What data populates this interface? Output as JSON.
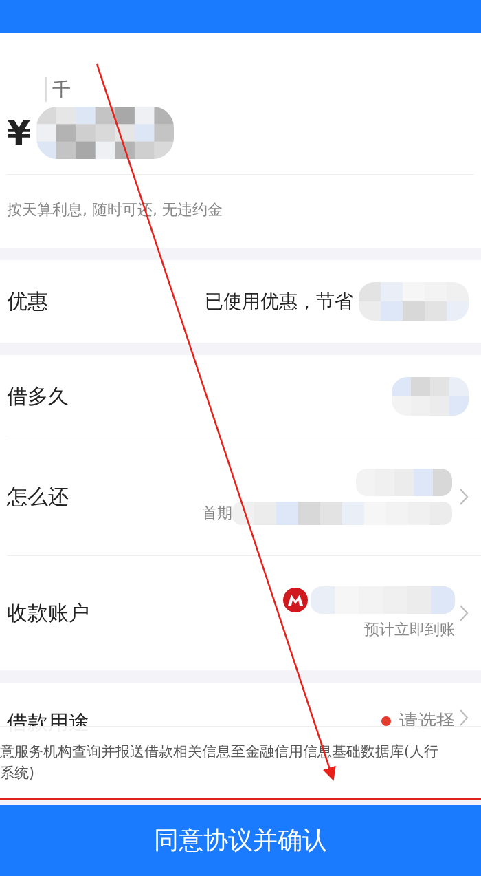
{
  "amount": {
    "unit": "千",
    "currency": "¥"
  },
  "note": "按天算利息, 随时可还, 无违约金",
  "sections": [
    {
      "rows": [
        {
          "kind": "value",
          "label": "优惠",
          "value": "已使用优惠，节省",
          "chevron": false
        }
      ]
    },
    {
      "rows": [
        {
          "kind": "blank",
          "label": "借多久",
          "chevron": false
        },
        {
          "kind": "repay",
          "label": "怎么还",
          "sub": "首期",
          "chevron": true
        },
        {
          "kind": "account",
          "label": "收款账户",
          "sub": "预计立即到账",
          "chevron": true
        }
      ]
    },
    {
      "rows": [
        {
          "kind": "select",
          "label": "借款用途",
          "value": "请选择",
          "chevron": true
        }
      ]
    }
  ],
  "disclosure": [
    "意服务机构查询并报送借款相关信息至金融信用信息基础数据库(人行",
    "系统)"
  ],
  "confirm_button": "同意协议并确认"
}
